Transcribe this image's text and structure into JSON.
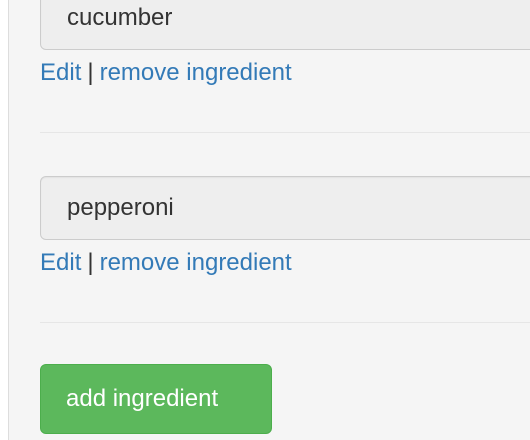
{
  "ingredients": [
    {
      "name": "cucumber",
      "edit_label": "Edit",
      "separator": "|",
      "remove_label": "remove ingredient"
    },
    {
      "name": "pepperoni",
      "edit_label": "Edit",
      "separator": "|",
      "remove_label": "remove ingredient"
    }
  ],
  "actions": {
    "add_label": "add ingredient"
  },
  "colors": {
    "link": "#337ab7",
    "success": "#5cb85c",
    "panel_bg": "#f5f5f5",
    "item_bg": "#eeeeee"
  }
}
